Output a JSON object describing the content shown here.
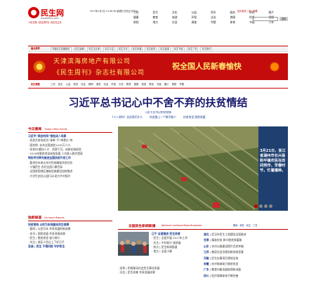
{
  "header": {
    "logo_text": "民生网",
    "logo_domain": "msweekly.com",
    "logo_slogan": "人民日报《民生周刊》杂志社主办",
    "date_line": "2017年2月2日 14:46:38 星期四 农历正月初六",
    "top_links": "设为首页 | 加入收藏",
    "search_button": "搜索",
    "nav": [
      "三农",
      "民生",
      "文化",
      "公益",
      "资讯",
      "政务",
      "评论",
      "图片",
      "健康",
      "教育",
      "旅游",
      "环保",
      "法治",
      "舆情",
      "时尚",
      "视频",
      "财经",
      "地方",
      "社会",
      "调查",
      "专题",
      "体育",
      "书画",
      "汽车"
    ]
  },
  "topbar": {
    "title": "重点推荐",
    "items": [
      "中国民生发展报告",
      "民生品牌",
      "民生企业家",
      "民生公益",
      "民生文化",
      "民生传媒",
      "民生政务",
      "民生健康",
      "民生书画",
      "民生三农",
      "民生快讯"
    ]
  },
  "banner": {
    "line1": "天津滨海房地产有限公司",
    "line2": "《民生周刊》杂志社有限公司",
    "greeting": "祝全国人民新春愉快",
    "colors": {
      "background": "#c40c0c",
      "text": "#ffe66e"
    }
  },
  "channels": {
    "title": "民生频道",
    "items": [
      "三农",
      "民生",
      "公益",
      "政务",
      "社会",
      "舆情",
      "调查",
      "法治",
      "环保",
      "文化",
      "教育",
      "健康",
      "旅游",
      "财经",
      "书画",
      "图片",
      "视频",
      "专题"
    ]
  },
  "headline": {
    "title": "习近平总书记心中不舍不弃的扶贫情结",
    "sub1": "习近平总书记的扶贫情",
    "sub2": [
      "《十八洞村》告诉我们什么",
      "扶贫路上一个都不能少",
      "扶贫攻坚 脱贫致富"
    ]
  },
  "today": {
    "title": "今日要闻",
    "en": "Today's Main Events",
    "items": [
      "习近平“两会时间”那些动人场景",
      "· 扶贫开发的成功“清单”子“啃骨头”的",
      "· 国务院: 去年全国减贫1240万人口",
      "· 扶贫村:最佳人才、资源下沉、创新实践经验",
      "· 2016年脱贫攻坚成效显著 人均收入稳步提高",
      "特别专刊率先推进全国扶贫开发工作",
      "· 要求在未来五年内完成精准扶贫任务",
      "· 小镇民生 农村全面小康目标",
      "· 全国贫困地区基础设施建设加快推进",
      "· 大学生创业公益行动 助力乡村振兴"
    ]
  },
  "exclusive": {
    "title": "独家报道",
    "en": "Exclusive Reports",
    "items": [
      "扶贫前线 以民为本保基本民生保障",
      "· 要闻 | 以民为本 共享发展的新成果",
      "· 本刊 | 国家发展 共享改革成果",
      "· 民生 | 脱贫攻坚 奋力前行",
      "· 关注 | 老区人民过上了好日子",
      "至诚 | 民生 不惧风险 守护民生"
    ]
  },
  "slide": {
    "caption": "3月21日，浙江省湖州市长兴县和平镇农民在田间劳作，早春时节，忙着播种。",
    "active_dot": 0,
    "dot_count": 4
  },
  "linkage": {
    "title": "全国民生新闻联播",
    "en": "National Livelihood News Broadcast",
    "tabs": [
      "要闻",
      "政务",
      "民生",
      "三农"
    ],
    "mid": [
      "辽宁 全面推进 民生改善",
      "· 民生 | 全面开展 2017年工作",
      "· 关注 | 乡村振兴 高质量",
      "· 热点 | 民生新闻报道",
      "· 地方 | 全面小康"
    ],
    "mid2": [
      "· 深圳 | 积极推动社会民生事业发展",
      "· 河北 | 民生改善 共享发展成果"
    ],
    "right": [
      {
        "tag": "湖北",
        "text": "武汉市民生工程建设全面推进"
      },
      {
        "tag": "甘肃",
        "text": "精准扶贫 群众脱贫致富路"
      },
      {
        "tag": "山东",
        "text": "农村公路建设提升百姓幸福"
      },
      {
        "tag": "江苏",
        "text": "基层社会治理创新成效显著"
      },
      {
        "tag": "河南",
        "text": "民生实事项目落地见效"
      },
      {
        "tag": "安徽",
        "text": "农村电商助力脱贫攻坚"
      },
      {
        "tag": "广东",
        "text": "教育均衡发展取得新进展"
      },
      {
        "tag": "四川",
        "text": "医疗保障体系不断完善"
      }
    ]
  },
  "colors": {
    "accent": "#c00000",
    "link": "#1a3d8f"
  }
}
